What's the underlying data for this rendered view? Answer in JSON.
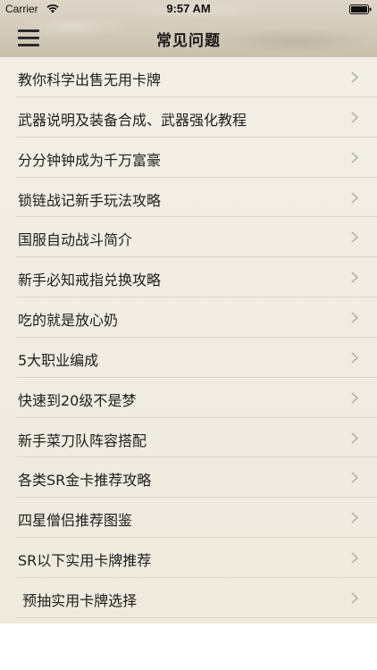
{
  "status_bar": {
    "carrier": "Carrier",
    "time": "9:57 AM"
  },
  "nav": {
    "title": "常见问题",
    "menu_icon": "hamburger-menu-icon"
  },
  "list": {
    "chevron_icon": "chevron-right-icon",
    "items": [
      {
        "label": "教你科学出售无用卡牌"
      },
      {
        "label": "武器说明及装备合成、武器强化教程"
      },
      {
        "label": "分分钟钟成为千万富豪"
      },
      {
        "label": "锁链战记新手玩法攻略"
      },
      {
        "label": "国服自动战斗简介"
      },
      {
        "label": "新手必知戒指兑换攻略"
      },
      {
        "label": "吃的就是放心奶"
      },
      {
        "label": "5大职业编成"
      },
      {
        "label": "快速到20级不是梦"
      },
      {
        "label": "新手菜刀队阵容搭配"
      },
      {
        "label": "各类SR金卡推荐攻略"
      },
      {
        "label": "四星僧侣推荐图鉴"
      },
      {
        "label": "SR以下实用卡牌推荐"
      },
      {
        "label": " 预抽实用卡牌选择"
      }
    ]
  },
  "colors": {
    "header_bg": "#d2cab9",
    "list_bg": "#f1ece2",
    "separator": "#dcd5c8",
    "text": "#1e1e1e",
    "chevron": "#b8b2a8"
  }
}
